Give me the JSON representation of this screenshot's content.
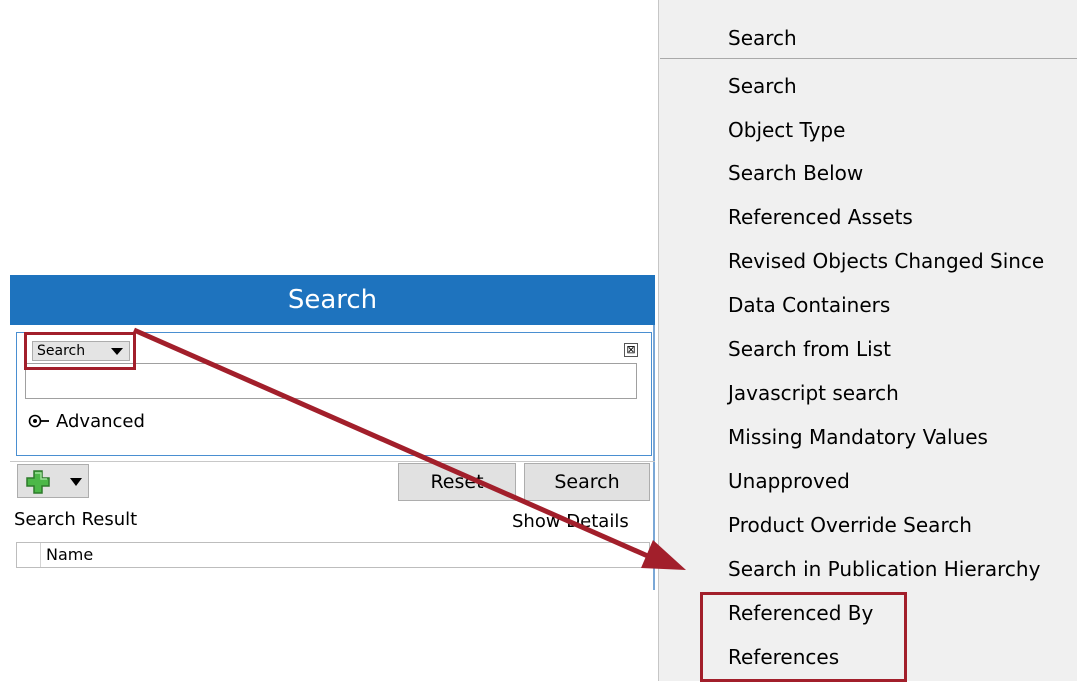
{
  "search_panel": {
    "title": "Search",
    "search_type_dropdown": "Search",
    "close_glyph": "⊠",
    "query_value": "",
    "advanced_label": "Advanced",
    "reset_label": "Reset",
    "search_label": "Search",
    "result_label": "Search Result",
    "show_details_label": "Show Details",
    "column_header": "Name"
  },
  "context_menu": {
    "header": "Search",
    "items": [
      "Search",
      "Object Type",
      "Search Below",
      "Referenced Assets",
      "Revised Objects Changed Since",
      "Data Containers",
      "Search from List",
      "Javascript search",
      "Missing Mandatory Values",
      "Unapproved",
      "Product Override Search",
      "Search in Publication Hierarchy",
      "Referenced By",
      "References"
    ]
  },
  "icons": {
    "add": "plus-icon",
    "advanced": "advanced-toggle-icon",
    "close": "close-icon"
  },
  "colors": {
    "header_blue": "#1e73be",
    "highlight_red": "#a21f2b",
    "plus_green": "#4cb848"
  }
}
